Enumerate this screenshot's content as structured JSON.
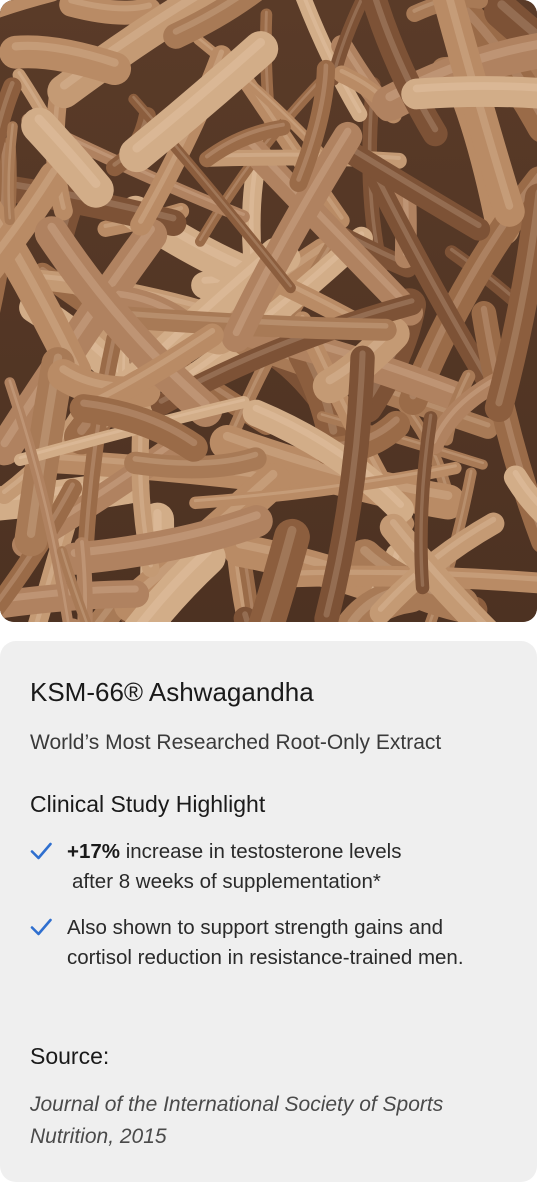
{
  "hero": {
    "image_description_name": "ashwagandha-roots-image"
  },
  "card": {
    "title": "KSM-66® Ashwagandha",
    "subtitle": "World’s Most Researched Root-Only Extract",
    "section_title": "Clinical Study Highlight",
    "highlights": [
      {
        "stat": "+17%",
        "text_line1": " increase in testosterone levels",
        "text_line2": "after 8 weeks of supplementation*"
      },
      {
        "text": "Also shown to support strength gains and cortisol reduction in resistance-trained men."
      }
    ],
    "source_label": "Source:",
    "source_text": "Journal of the International Society of Sports Nutrition, 2015"
  },
  "colors": {
    "check": "#2f6fcf",
    "card_bg": "#efefef",
    "root_dark": "#6e4a33",
    "root_light": "#c9a27c"
  }
}
